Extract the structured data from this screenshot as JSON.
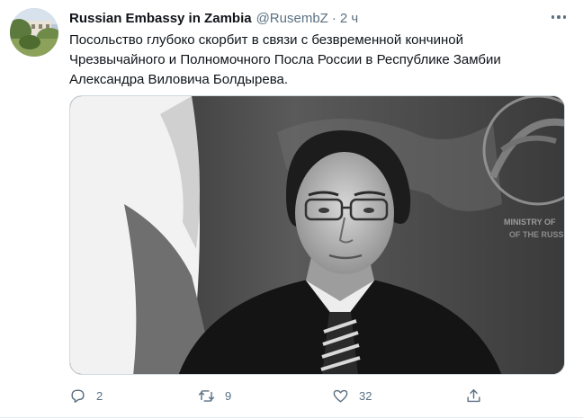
{
  "tweet": {
    "author_name": "Russian Embassy in Zambia",
    "handle": "@RusembZ",
    "separator": "·",
    "time": "2 ч",
    "text_lines": [
      "Посольство глубоко скорбит в связи с безвременной кончиной",
      "Чрезвычайного и Полномочного Посла России в Республике Замбии",
      "Александра Виловича Болдырева."
    ],
    "media_emblem_text": [
      "MINISTRY OF",
      "OF THE RUSS"
    ],
    "actions": {
      "reply_count": "2",
      "retweet_count": "9",
      "like_count": "32",
      "share_count": ""
    }
  },
  "icons": {
    "more": "more-horizontal-icon",
    "reply": "reply-icon",
    "retweet": "retweet-icon",
    "like": "heart-icon",
    "share": "share-icon"
  },
  "colors": {
    "text_primary": "#0f1419",
    "text_secondary": "#5b7083",
    "border": "#cfd9de"
  }
}
